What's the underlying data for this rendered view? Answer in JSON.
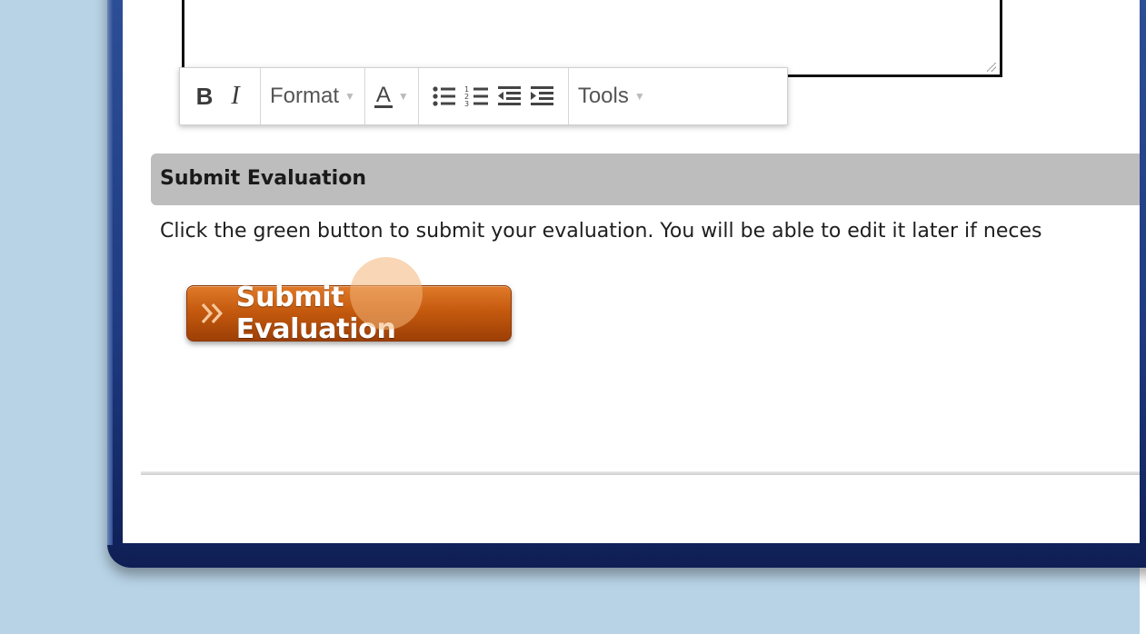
{
  "editor": {
    "toolbar": {
      "bold_label": "B",
      "italic_label": "I",
      "format_label": "Format",
      "text_color_label": "A",
      "tools_label": "Tools",
      "icons": [
        "bulleted-list-icon",
        "numbered-list-icon",
        "outdent-icon",
        "indent-icon"
      ]
    }
  },
  "section": {
    "title": "Submit Evaluation",
    "instructions": "Click the green button to submit your evaluation. You will be able to edit it later if neces"
  },
  "submit_button": {
    "label": "Submit Evaluation",
    "icon": "double-chevron-right-icon"
  },
  "colors": {
    "backdrop": "#b8d3e6",
    "frame": "#1f3a80",
    "section_bar": "#bdbdbd",
    "button": "#c55a0e"
  }
}
